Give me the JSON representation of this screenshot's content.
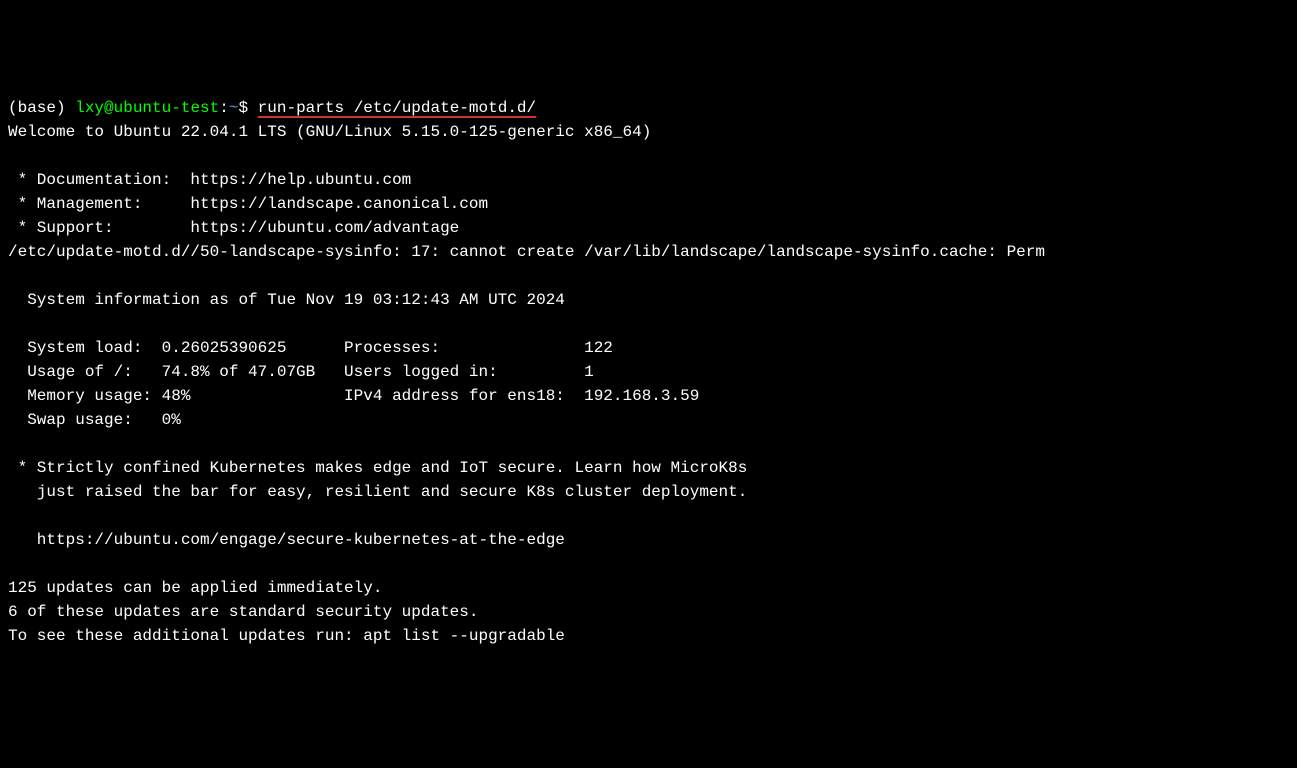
{
  "prompt": {
    "base": "(base) ",
    "user_host": "lxy@ubuntu-test",
    "colon": ":",
    "tilde": "~",
    "dollar": "$ ",
    "command": "run-parts /etc/update-motd.d/",
    "underlined_command": " run-parts /etc/update-motd.d/"
  },
  "welcome": "Welcome to Ubuntu 22.04.1 LTS (GNU/Linux 5.15.0-125-generic x86_64)",
  "links": {
    "documentation": " * Documentation:  https://help.ubuntu.com",
    "management": " * Management:     https://landscape.canonical.com",
    "support": " * Support:        https://ubuntu.com/advantage"
  },
  "error": "/etc/update-motd.d//50-landscape-sysinfo: 17: cannot create /var/lib/landscape/landscape-sysinfo.cache: Perm",
  "sysinfo_header": "  System information as of Tue Nov 19 03:12:43 AM UTC 2024",
  "sysinfo": {
    "line1": "  System load:  0.26025390625      Processes:               122",
    "line2": "  Usage of /:   74.8% of 47.07GB   Users logged in:         1",
    "line3": "  Memory usage: 48%                IPv4 address for ens18:  192.168.3.59",
    "line4": "  Swap usage:   0%"
  },
  "promo": {
    "line1": " * Strictly confined Kubernetes makes edge and IoT secure. Learn how MicroK8s",
    "line2": "   just raised the bar for easy, resilient and secure K8s cluster deployment.",
    "url": "   https://ubuntu.com/engage/secure-kubernetes-at-the-edge"
  },
  "updates": {
    "line1": "125 updates can be applied immediately.",
    "line2": "6 of these updates are standard security updates.",
    "line3": "To see these additional updates run: apt list --upgradable"
  }
}
